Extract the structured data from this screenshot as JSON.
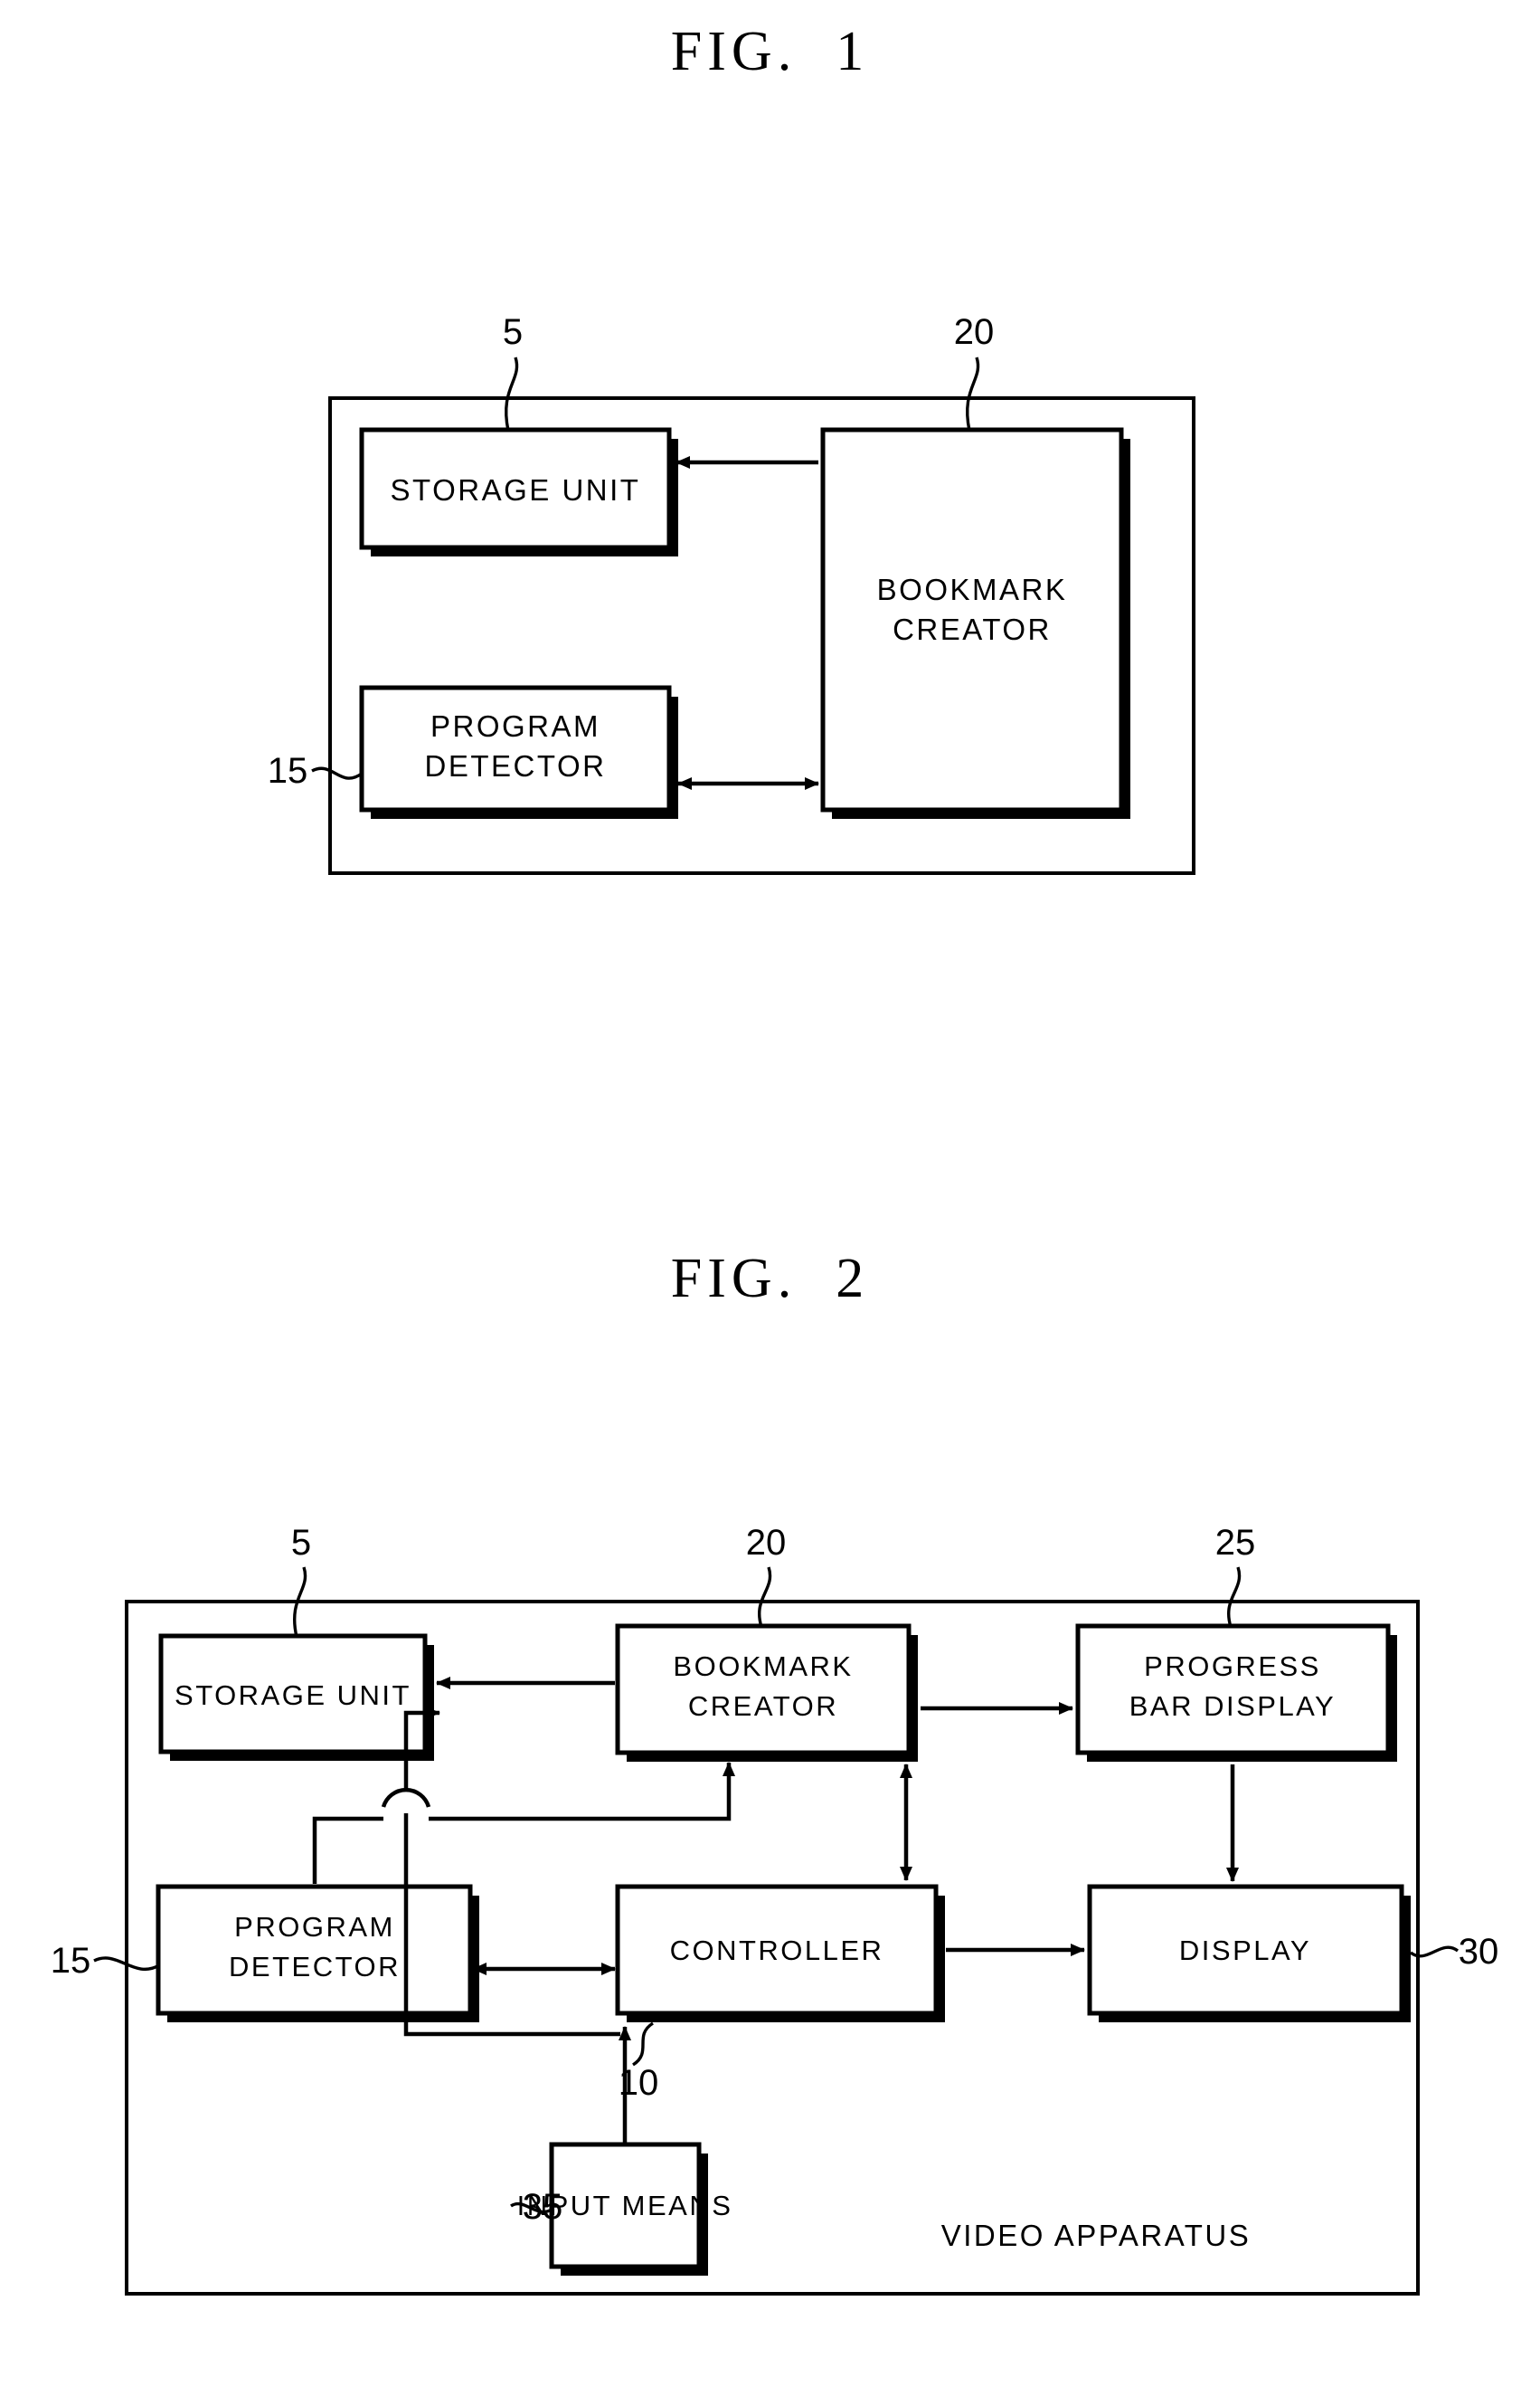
{
  "document": {
    "type": "patent-drawing-sheet",
    "figures": [
      {
        "id": "fig1",
        "title": "FIG.  1",
        "outer_container": {
          "label": "",
          "ref": ""
        },
        "blocks": [
          {
            "name": "storage-unit",
            "label": "STORAGE UNIT",
            "ref": "5"
          },
          {
            "name": "program-detector",
            "label_line1": "PROGRAM",
            "label_line2": "DETECTOR",
            "ref": "15"
          },
          {
            "name": "bookmark-creator",
            "label_line1": "BOOKMARK",
            "label_line2": "CREATOR",
            "ref": "20"
          }
        ],
        "connections": [
          {
            "from": "bookmark-creator",
            "to": "storage-unit",
            "direction": "single"
          },
          {
            "from": "program-detector",
            "to": "bookmark-creator",
            "direction": "double"
          }
        ]
      },
      {
        "id": "fig2",
        "title": "FIG.  2",
        "outer_container": {
          "label": "VIDEO APPARATUS"
        },
        "blocks": [
          {
            "name": "storage-unit",
            "label": "STORAGE UNIT",
            "ref": "5"
          },
          {
            "name": "bookmark-creator",
            "label_line1": "BOOKMARK",
            "label_line2": "CREATOR",
            "ref": "20"
          },
          {
            "name": "progress-bar-display",
            "label_line1": "PROGRESS",
            "label_line2": "BAR DISPLAY",
            "ref": "25"
          },
          {
            "name": "program-detector",
            "label_line1": "PROGRAM",
            "label_line2": "DETECTOR",
            "ref": "15"
          },
          {
            "name": "controller",
            "label": "CONTROLLER",
            "ref": "10"
          },
          {
            "name": "display",
            "label": "DISPLAY",
            "ref": "30"
          },
          {
            "name": "input-means",
            "label": "INPUT MEANS",
            "ref": "35"
          }
        ],
        "connections": [
          {
            "from": "bookmark-creator",
            "to": "storage-unit",
            "direction": "single"
          },
          {
            "from": "bookmark-creator",
            "to": "progress-bar-display",
            "direction": "single"
          },
          {
            "from": "controller",
            "to": "bookmark-creator",
            "direction": "double"
          },
          {
            "from": "controller",
            "to": "storage-unit",
            "direction": "single"
          },
          {
            "from": "program-detector",
            "to": "bookmark-creator",
            "direction": "single"
          },
          {
            "from": "program-detector",
            "to": "controller",
            "direction": "double"
          },
          {
            "from": "controller",
            "to": "display",
            "direction": "single"
          },
          {
            "from": "progress-bar-display",
            "to": "display",
            "direction": "single"
          },
          {
            "from": "input-means",
            "to": "controller",
            "direction": "single"
          }
        ]
      }
    ]
  },
  "colors": {
    "ink": "#000000",
    "paper": "#ffffff"
  }
}
